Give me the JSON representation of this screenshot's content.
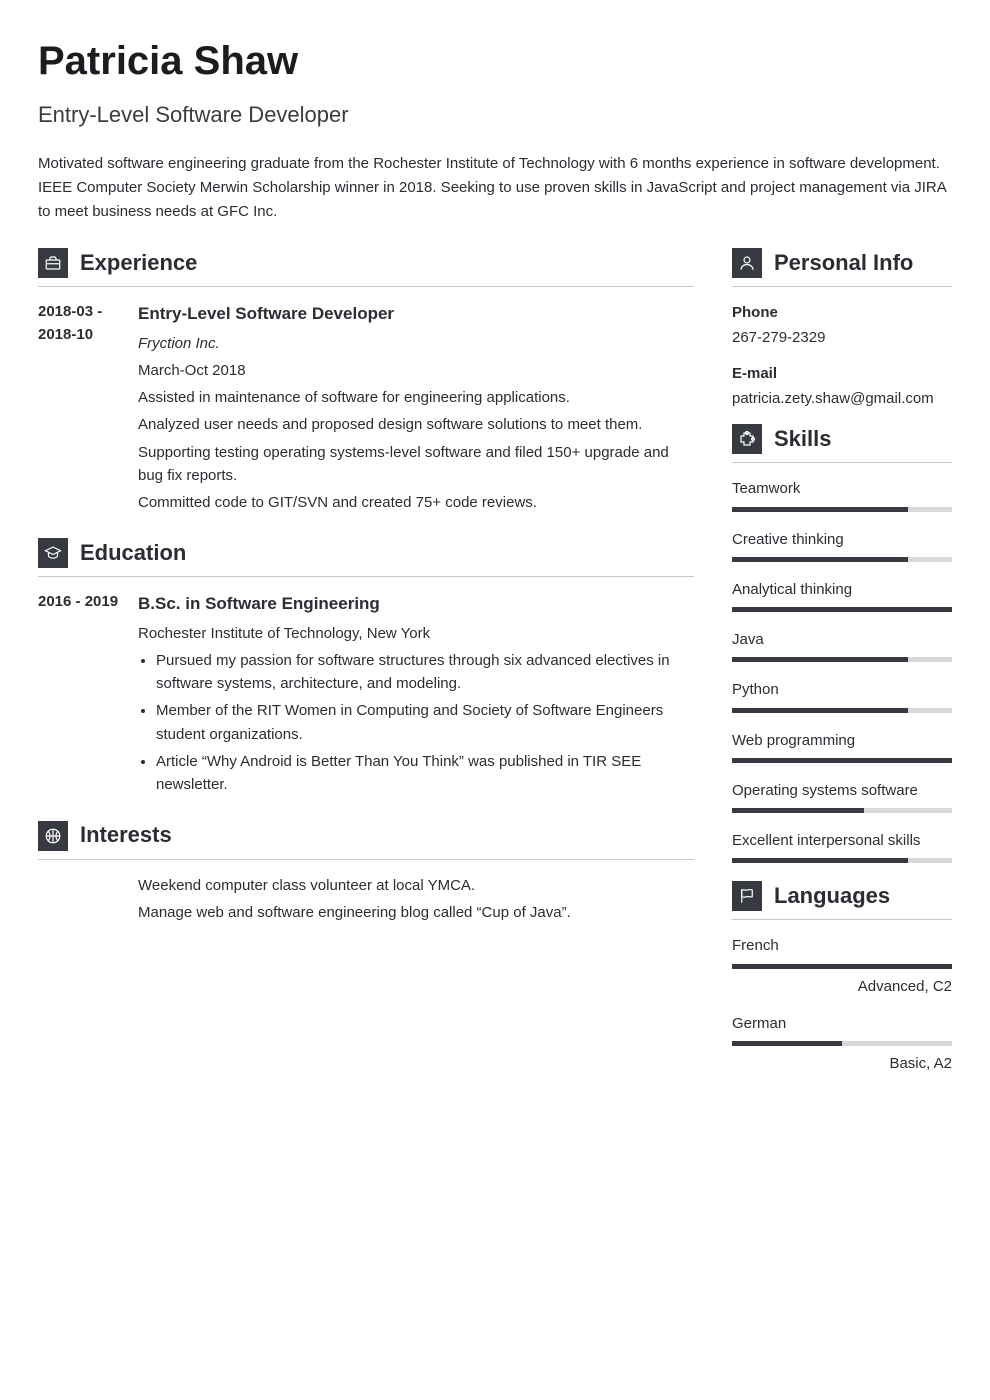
{
  "header": {
    "name": "Patricia Shaw",
    "title": "Entry-Level Software Developer",
    "summary": "Motivated software engineering graduate from the Rochester Institute of Technology with 6 months experience in software development. IEEE Computer Society Merwin Scholarship winner in 2018. Seeking to use proven skills in JavaScript and project management via JIRA to meet business needs at GFC Inc."
  },
  "sections": {
    "experience": {
      "title": "Experience"
    },
    "education": {
      "title": "Education"
    },
    "interests": {
      "title": "Interests"
    },
    "personal": {
      "title": "Personal Info"
    },
    "skills": {
      "title": "Skills"
    },
    "languages": {
      "title": "Languages"
    }
  },
  "experience": [
    {
      "date": "2018-03 - 2018-10",
      "role": "Entry-Level Software Developer",
      "org": "Fryction Inc.",
      "daterange": "March-Oct 2018",
      "lines": [
        "Assisted in maintenance of software for engineering applications.",
        "Analyzed user needs and proposed design software solutions to meet them.",
        "Supporting testing operating systems-level software and filed 150+ upgrade and bug fix reports.",
        "Committed code to GIT/SVN and created 75+ code reviews."
      ]
    }
  ],
  "education": [
    {
      "date": "2016 - 2019",
      "degree": "B.Sc. in Software Engineering",
      "school": "Rochester Institute of Technology, New York",
      "bullets": [
        "Pursued my passion for software structures through six advanced electives in software systems, architecture, and modeling.",
        "Member of the RIT Women in Computing and Society of Software Engineers student organizations.",
        "Article “Why Android is Better Than You Think” was published in TIR SEE newsletter."
      ]
    }
  ],
  "interests": [
    "Weekend computer class volunteer at local YMCA.",
    "Manage web and software engineering blog called “Cup of Java”."
  ],
  "personal": {
    "phone_label": "Phone",
    "phone": "267-279-2329",
    "email_label": "E-mail",
    "email": "patricia.zety.shaw@gmail.com"
  },
  "skills": [
    {
      "name": "Teamwork",
      "pct": 80
    },
    {
      "name": "Creative thinking",
      "pct": 80
    },
    {
      "name": "Analytical thinking",
      "pct": 100
    },
    {
      "name": "Java",
      "pct": 80
    },
    {
      "name": "Python",
      "pct": 80
    },
    {
      "name": "Web programming",
      "pct": 100
    },
    {
      "name": "Operating systems software",
      "pct": 60
    },
    {
      "name": "Excellent interpersonal skills",
      "pct": 80
    }
  ],
  "languages": [
    {
      "name": "French",
      "pct": 100,
      "level": "Advanced, C2"
    },
    {
      "name": "German",
      "pct": 50,
      "level": "Basic, A2"
    }
  ]
}
